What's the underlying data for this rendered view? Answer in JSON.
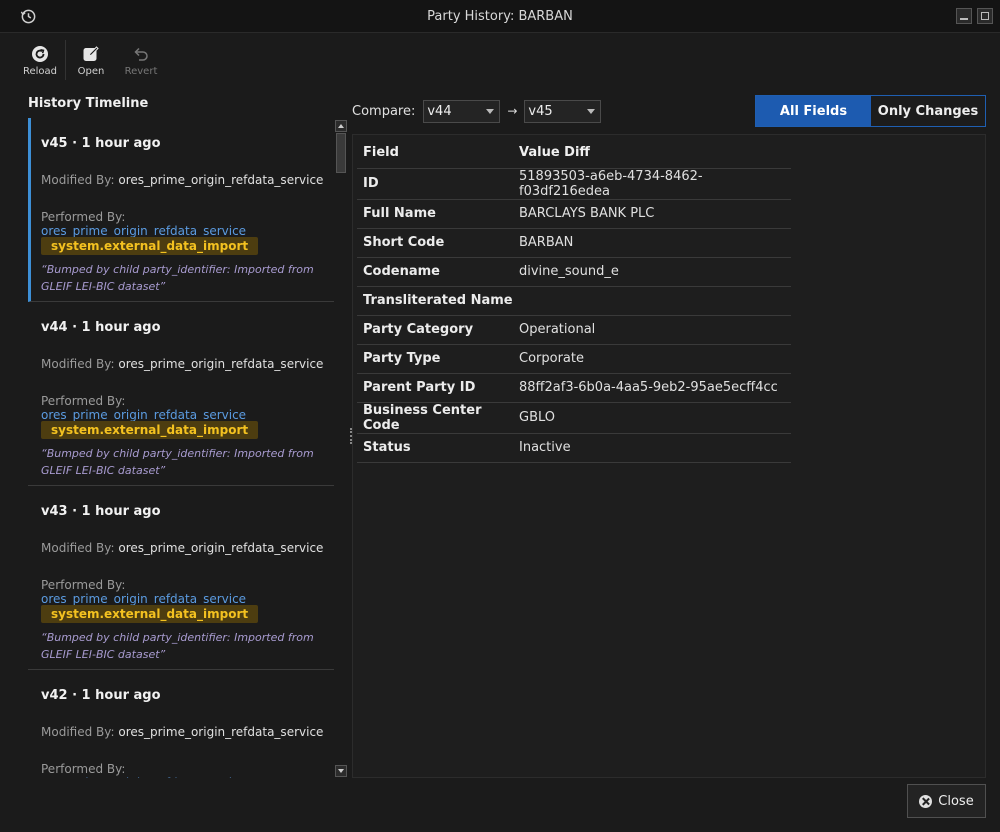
{
  "window": {
    "title": "Party History: BARBAN"
  },
  "toolbar": {
    "reload_label": "Reload",
    "open_label": "Open",
    "revert_label": "Revert"
  },
  "history": {
    "title": "History Timeline",
    "modified_label": "Modified By:",
    "performed_label": "Performed By:",
    "entries": [
      {
        "version": "v45 · 1 hour ago",
        "modified_by": "ores_prime_origin_refdata_service",
        "performed_by": "ores_prime_origin_refdata_service",
        "tag": "system.external_data_import",
        "comment": "“Bumped by child party_identifier: Imported from GLEIF LEI-BIC dataset”"
      },
      {
        "version": "v44 · 1 hour ago",
        "modified_by": "ores_prime_origin_refdata_service",
        "performed_by": "ores_prime_origin_refdata_service",
        "tag": "system.external_data_import",
        "comment": "“Bumped by child party_identifier: Imported from GLEIF LEI-BIC dataset”"
      },
      {
        "version": "v43 · 1 hour ago",
        "modified_by": "ores_prime_origin_refdata_service",
        "performed_by": "ores_prime_origin_refdata_service",
        "tag": "system.external_data_import",
        "comment": "“Bumped by child party_identifier: Imported from GLEIF LEI-BIC dataset”"
      },
      {
        "version": "v42 · 1 hour ago",
        "modified_by": "ores_prime_origin_refdata_service",
        "performed_by": "ores_prime_origin_refdata_service"
      }
    ]
  },
  "compare": {
    "label": "Compare:",
    "from": "v44",
    "arrow": "→",
    "to": "v45"
  },
  "view_toggle": {
    "all_fields": "All Fields",
    "only_changes": "Only Changes"
  },
  "diff": {
    "headers": {
      "field": "Field",
      "value": "Value Diff"
    },
    "rows": [
      {
        "field": "ID",
        "value": "51893503-a6eb-4734-8462-f03df216edea"
      },
      {
        "field": "Full Name",
        "value": "BARCLAYS BANK PLC"
      },
      {
        "field": "Short Code",
        "value": "BARBAN"
      },
      {
        "field": "Codename",
        "value": "divine_sound_e"
      },
      {
        "field": "Transliterated Name",
        "value": ""
      },
      {
        "field": "Party Category",
        "value": "Operational"
      },
      {
        "field": "Party Type",
        "value": "Corporate"
      },
      {
        "field": "Parent Party ID",
        "value": "88ff2af3-6b0a-4aa5-9eb2-95ae5ecff4cc"
      },
      {
        "field": "Business Center Code",
        "value": "GBLO"
      },
      {
        "field": "Status",
        "value": "Inactive"
      }
    ]
  },
  "footer": {
    "close_label": "Close"
  },
  "colors": {
    "accent": "#1d5bb0",
    "link": "#5b9be0",
    "tag_bg": "#4d3d10",
    "tag_text": "#f4c220",
    "comment": "#a89bd0",
    "selected_marker": "#3d8fd6"
  }
}
